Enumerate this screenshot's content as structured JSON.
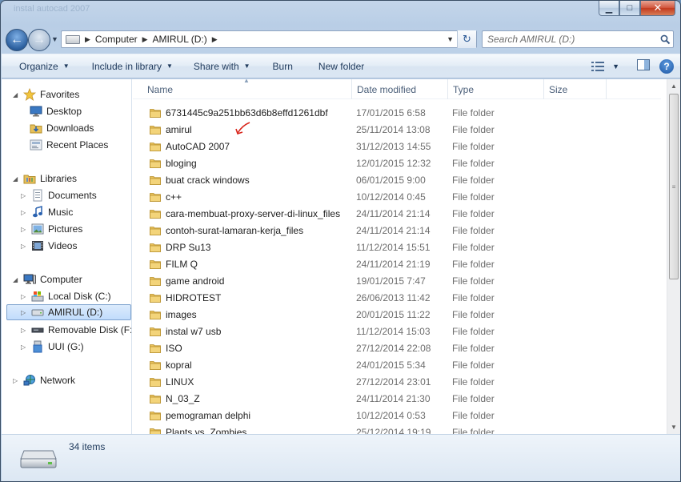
{
  "window": {
    "ghost_title": "instal autocad 2007",
    "controls": {
      "minimize": "▁",
      "maximize": "□",
      "close": "✕"
    }
  },
  "nav": {
    "back_icon": "arrow-left-icon",
    "forward_icon": "arrow-right-icon",
    "breadcrumb": [
      "Computer",
      "AMIRUL (D:)"
    ],
    "search_placeholder": "Search AMIRUL (D:)"
  },
  "toolbar": {
    "organize": "Organize",
    "include_in_library": "Include in library",
    "share_with": "Share with",
    "burn": "Burn",
    "new_folder": "New folder"
  },
  "sidebar": {
    "favorites": {
      "label": "Favorites",
      "items": [
        "Desktop",
        "Downloads",
        "Recent Places"
      ]
    },
    "libraries": {
      "label": "Libraries",
      "items": [
        "Documents",
        "Music",
        "Pictures",
        "Videos"
      ]
    },
    "computer": {
      "label": "Computer",
      "items": [
        "Local Disk (C:)",
        "AMIRUL (D:)",
        "Removable Disk (F:)",
        "UUI (G:)"
      ]
    },
    "network": {
      "label": "Network"
    }
  },
  "columns": {
    "name": "Name",
    "date": "Date modified",
    "type": "Type",
    "size": "Size"
  },
  "files": [
    {
      "name": "6731445c9a251bb63d6b8effd1261dbf",
      "date": "17/01/2015 6:58",
      "type": "File folder"
    },
    {
      "name": "amirul",
      "date": "25/11/2014 13:08",
      "type": "File folder"
    },
    {
      "name": "AutoCAD 2007",
      "date": "31/12/2013 14:55",
      "type": "File folder"
    },
    {
      "name": "bloging",
      "date": "12/01/2015 12:32",
      "type": "File folder"
    },
    {
      "name": "buat crack windows",
      "date": "06/01/2015 9:00",
      "type": "File folder"
    },
    {
      "name": "c++",
      "date": "10/12/2014 0:45",
      "type": "File folder"
    },
    {
      "name": "cara-membuat-proxy-server-di-linux_files",
      "date": "24/11/2014 21:14",
      "type": "File folder"
    },
    {
      "name": "contoh-surat-lamaran-kerja_files",
      "date": "24/11/2014 21:14",
      "type": "File folder"
    },
    {
      "name": "DRP Su13",
      "date": "11/12/2014 15:51",
      "type": "File folder"
    },
    {
      "name": "FILM Q",
      "date": "24/11/2014 21:19",
      "type": "File folder"
    },
    {
      "name": "game android",
      "date": "19/01/2015 7:47",
      "type": "File folder"
    },
    {
      "name": "HIDROTEST",
      "date": "26/06/2013 11:42",
      "type": "File folder"
    },
    {
      "name": "images",
      "date": "20/01/2015 11:22",
      "type": "File folder"
    },
    {
      "name": "instal w7 usb",
      "date": "11/12/2014 15:03",
      "type": "File folder"
    },
    {
      "name": "ISO",
      "date": "27/12/2014 22:08",
      "type": "File folder"
    },
    {
      "name": "kopral",
      "date": "24/01/2015 5:34",
      "type": "File folder"
    },
    {
      "name": "LINUX",
      "date": "27/12/2014 23:01",
      "type": "File folder"
    },
    {
      "name": "N_03_Z",
      "date": "24/11/2014 21:30",
      "type": "File folder"
    },
    {
      "name": "pemograman delphi",
      "date": "10/12/2014 0:53",
      "type": "File folder"
    },
    {
      "name": "Plants vs. Zombies",
      "date": "25/12/2014 19:19",
      "type": "File folder"
    }
  ],
  "status": {
    "items_count": "34 items"
  },
  "colors": {
    "folder": "#e8c15a",
    "selection": "#c1dcfc",
    "accent": "#1e395b",
    "annotation": "#d9261c"
  }
}
